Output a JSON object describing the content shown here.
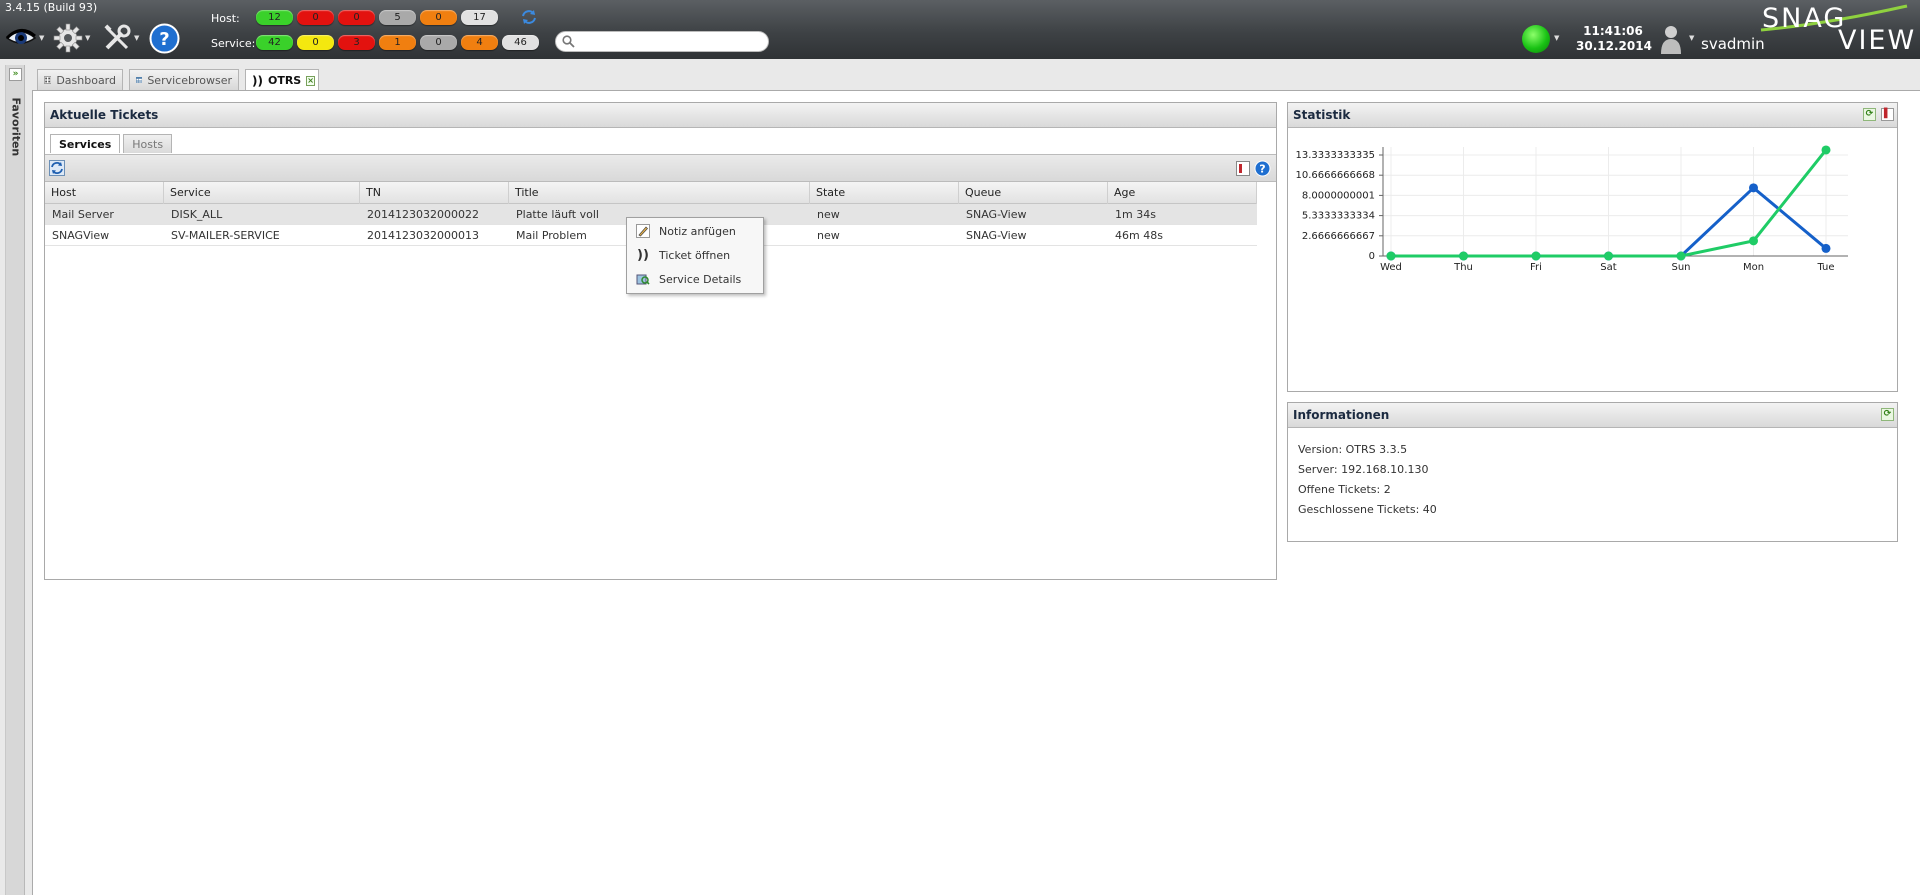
{
  "app": {
    "version": "3.4.15 (Build 93)",
    "username": "svadmin",
    "clock_time": "11:41:06",
    "clock_date": "30.12.2014",
    "logo_line1": "SNAG",
    "logo_line2": "VIEW"
  },
  "status": {
    "host_label": "Host:",
    "service_label": "Service:",
    "host_counters": [
      {
        "value": "12",
        "color": "#3ad12a"
      },
      {
        "value": "0",
        "color": "#e3120f"
      },
      {
        "value": "0",
        "color": "#e3120f"
      },
      {
        "value": "5",
        "color": "#a9a9a9"
      },
      {
        "value": "0",
        "color": "#f07f10"
      },
      {
        "value": "17",
        "color": "#e1e1e1"
      }
    ],
    "service_counters": [
      {
        "value": "42",
        "color": "#3ad12a"
      },
      {
        "value": "0",
        "color": "#f4e80f"
      },
      {
        "value": "3",
        "color": "#e3120f"
      },
      {
        "value": "1",
        "color": "#f07f10"
      },
      {
        "value": "0",
        "color": "#a9a9a9"
      },
      {
        "value": "4",
        "color": "#f07f10"
      },
      {
        "value": "46",
        "color": "#e1e1e1"
      }
    ]
  },
  "search": {
    "placeholder": ""
  },
  "sidebar": {
    "label": "Favoriten"
  },
  "main_tabs": [
    {
      "label": "Dashboard"
    },
    {
      "label": "Servicebrowser"
    },
    {
      "label": "OTRS"
    }
  ],
  "tickets": {
    "title": "Aktuelle Tickets",
    "sub_tabs": [
      "Services",
      "Hosts"
    ],
    "columns": [
      "Host",
      "Service",
      "TN",
      "Title",
      "State",
      "Queue",
      "Age"
    ],
    "rows": [
      [
        "Mail Server",
        "DISK_ALL",
        "2014123032000022",
        "Platte läuft voll",
        "new",
        "SNAG-View",
        "1m 34s"
      ],
      [
        "SNAGView",
        "SV-MAILER-SERVICE",
        "2014123032000013",
        "Mail Problem",
        "new",
        "SNAG-View",
        "46m 48s"
      ]
    ]
  },
  "context_menu": {
    "items": [
      "Notiz anfügen",
      "Ticket öffnen",
      "Service Details"
    ]
  },
  "statistik": {
    "title": "Statistik"
  },
  "info": {
    "title": "Informationen",
    "lines": [
      "Version: OTRS 3.3.5",
      "Server: 192.168.10.130",
      "Offene Tickets: 2",
      "Geschlossene Tickets: 40"
    ]
  },
  "chart_data": {
    "type": "line",
    "categories": [
      "Wed",
      "Thu",
      "Fri",
      "Sat",
      "Sun",
      "Mon",
      "Tue"
    ],
    "yticks": [
      "0",
      "2.6666666667",
      "5.3333333334",
      "8.0000000001",
      "10.6666666668",
      "13.3333333335"
    ],
    "ylim": [
      0,
      14
    ],
    "grid": true,
    "series": [
      {
        "values": [
          0,
          0,
          0,
          0,
          0,
          9,
          1
        ],
        "color": "#1560c9"
      },
      {
        "values": [
          0,
          0,
          0,
          0,
          0,
          2,
          14
        ],
        "color": "#1fcc66"
      }
    ]
  }
}
